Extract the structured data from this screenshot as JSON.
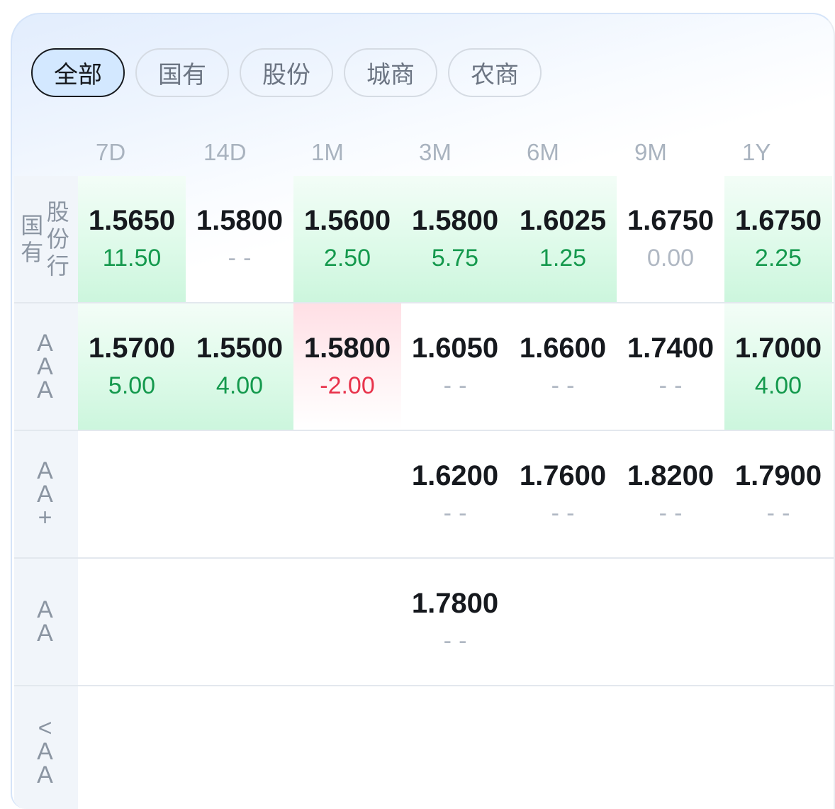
{
  "filters": {
    "items": [
      {
        "label": "全部",
        "selected": true
      },
      {
        "label": "国有",
        "selected": false
      },
      {
        "label": "股份",
        "selected": false
      },
      {
        "label": "城商",
        "selected": false
      },
      {
        "label": "农商",
        "selected": false
      }
    ]
  },
  "columns": [
    "7D",
    "14D",
    "1M",
    "3M",
    "6M",
    "9M",
    "1Y"
  ],
  "rows": [
    {
      "label": [
        "国有",
        "股份行"
      ],
      "cells": [
        {
          "rate": "1.5650",
          "change": "11.50"
        },
        {
          "rate": "1.5800",
          "change": "--"
        },
        {
          "rate": "1.5600",
          "change": "2.50"
        },
        {
          "rate": "1.5800",
          "change": "5.75"
        },
        {
          "rate": "1.6025",
          "change": "1.25"
        },
        {
          "rate": "1.6750",
          "change": "0.00"
        },
        {
          "rate": "1.6750",
          "change": "2.25"
        }
      ]
    },
    {
      "label": [
        "AAA"
      ],
      "cells": [
        {
          "rate": "1.5700",
          "change": "5.00"
        },
        {
          "rate": "1.5500",
          "change": "4.00"
        },
        {
          "rate": "1.5800",
          "change": "-2.00"
        },
        {
          "rate": "1.6050",
          "change": "--"
        },
        {
          "rate": "1.6600",
          "change": "--"
        },
        {
          "rate": "1.7400",
          "change": "--"
        },
        {
          "rate": "1.7000",
          "change": "4.00"
        }
      ]
    },
    {
      "label": [
        "AA+"
      ],
      "cells": [
        null,
        null,
        null,
        {
          "rate": "1.6200",
          "change": "--"
        },
        {
          "rate": "1.7600",
          "change": "--"
        },
        {
          "rate": "1.8200",
          "change": "--"
        },
        {
          "rate": "1.7900",
          "change": "--"
        }
      ]
    },
    {
      "label": [
        "AA"
      ],
      "cells": [
        null,
        null,
        null,
        {
          "rate": "1.7800",
          "change": "--"
        },
        null,
        null,
        null
      ]
    },
    {
      "label": [
        "<AA"
      ],
      "cells": [
        null,
        null,
        null,
        null,
        null,
        null,
        null
      ]
    }
  ],
  "colors": {
    "up": "#14994d",
    "down": "#e8334b",
    "flat": "#b0b8c3",
    "selected_fill": "#d3e8ff"
  }
}
